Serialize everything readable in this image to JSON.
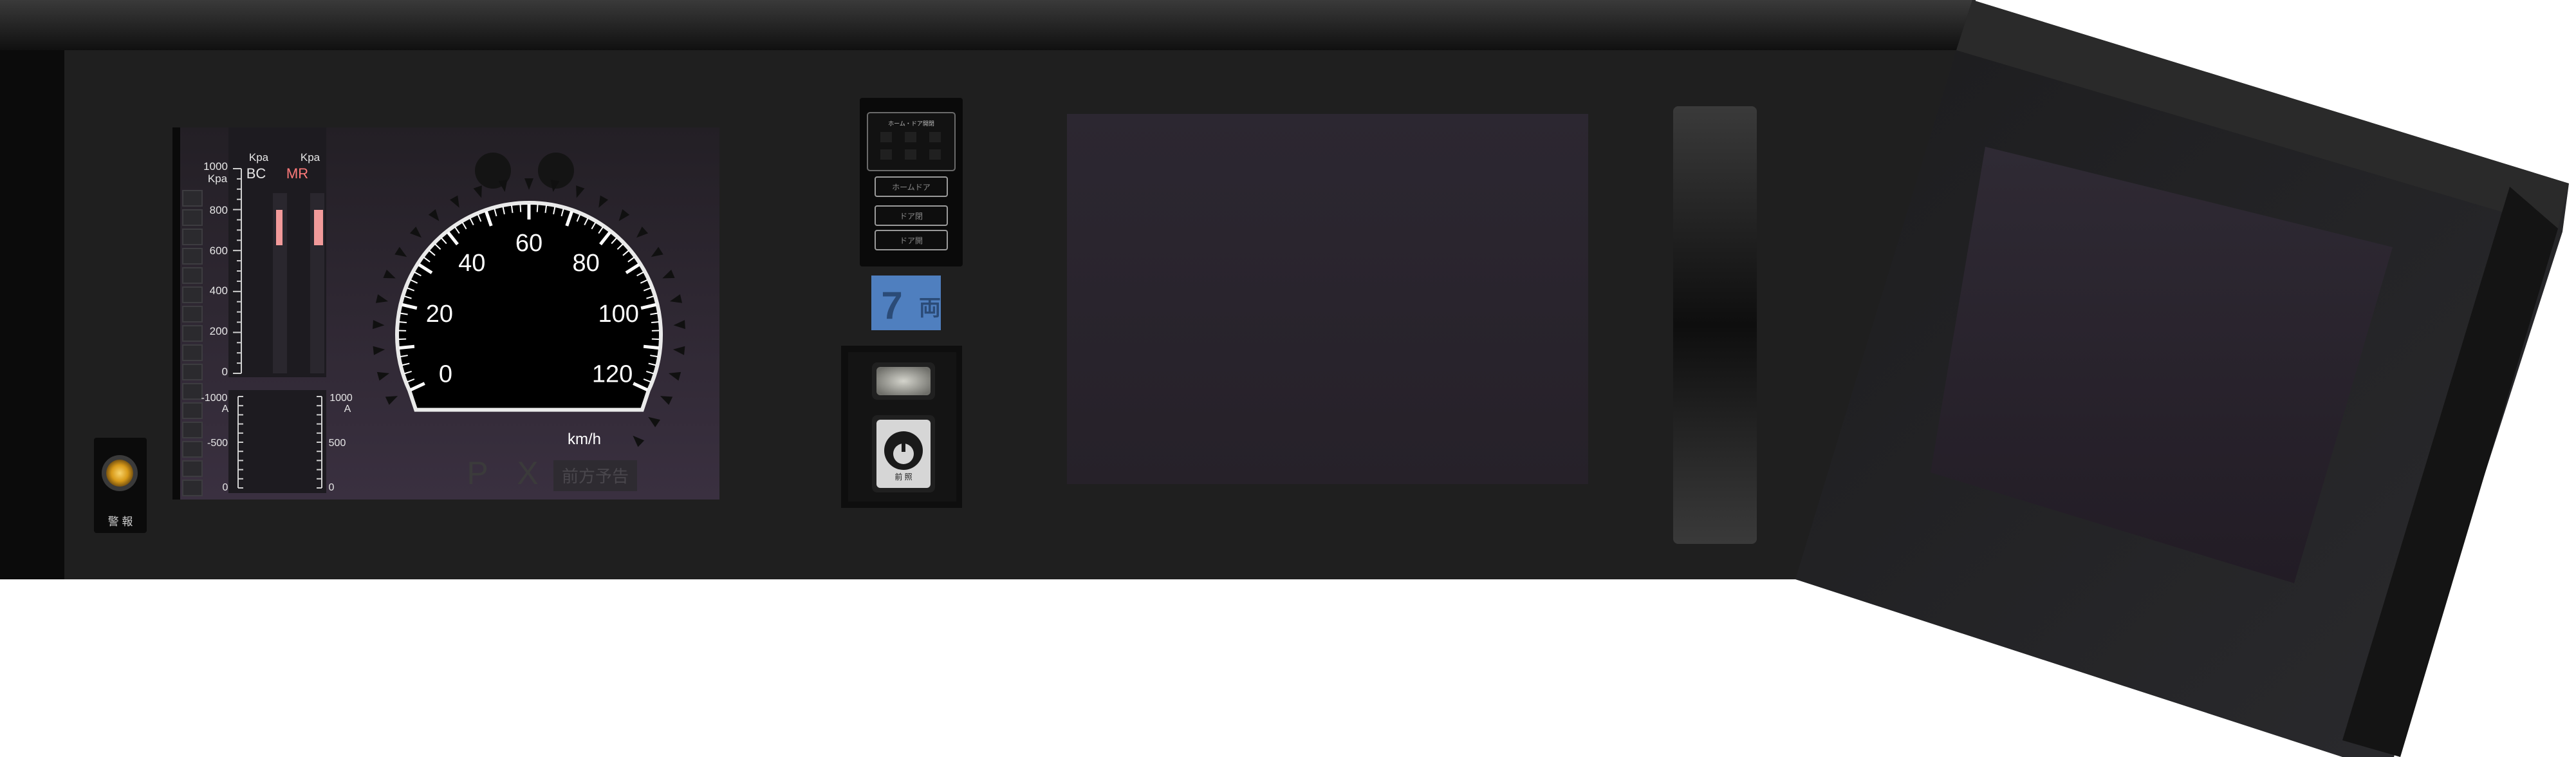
{
  "gauges": {
    "bc_unit": "Kpa",
    "bc_label": "BC",
    "mr_unit": "Kpa",
    "mr_label": "MR",
    "pressure_max_label": "1000",
    "pressure_max_unit": "Kpa",
    "pressure_ticks": [
      "800",
      "600",
      "400",
      "200",
      "0"
    ],
    "bc_value_kpa": 780,
    "mr_value_kpa": 810,
    "ammeter_left": [
      "-1000",
      "A",
      "-500",
      "0"
    ],
    "ammeter_right": [
      "1000",
      "A",
      "500",
      "0"
    ],
    "colors": {
      "mr_label": "#ff7a7a",
      "mr_bar": "#f29a9a",
      "bc_bar": "#f29a9a"
    }
  },
  "speedometer": {
    "labels": [
      "0",
      "20",
      "40",
      "60",
      "80",
      "100",
      "120"
    ],
    "unit": "km/h",
    "max": 120,
    "value": 0
  },
  "indicators": {
    "p_label": "P",
    "x_label": "X",
    "pattern_label": "前方予告"
  },
  "buzzer": {
    "label": "警 報"
  },
  "door_panel": {
    "title": "ホーム・ドア開閉",
    "labels": [
      "ホームドア",
      "ドア閉",
      "ドア開"
    ]
  },
  "car_number": {
    "value": "7",
    "suffix": "両"
  },
  "light_switch": {
    "label": "前 照"
  },
  "screens": {
    "main_display": "",
    "side_display": ""
  },
  "colors": {
    "panel": "#1f1f1f",
    "accent": "#4f7fbf",
    "screen": "#2a2431"
  }
}
